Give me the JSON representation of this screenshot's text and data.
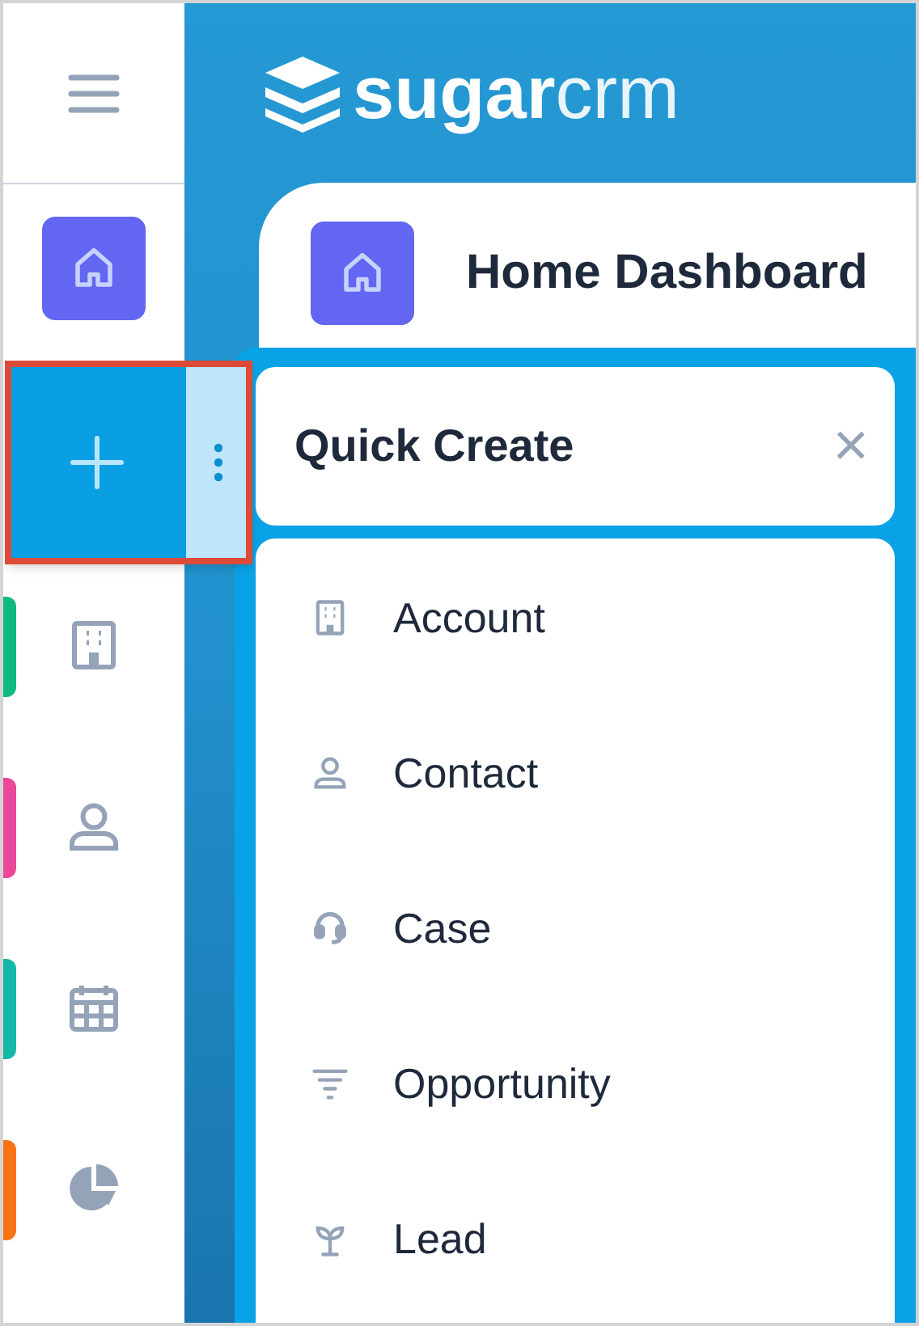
{
  "logo": {
    "bold": "sugar",
    "light": "crm"
  },
  "sidebar": {
    "items": [
      {
        "color": "#10b981"
      },
      {
        "color": "#ec4899"
      },
      {
        "color": "#14b8a6"
      },
      {
        "color": "#f97316"
      }
    ]
  },
  "dashboard": {
    "title": "Home Dashboard"
  },
  "quick_create": {
    "title": "Quick Create",
    "close": "×",
    "items": [
      {
        "label": "Account"
      },
      {
        "label": "Contact"
      },
      {
        "label": "Case"
      },
      {
        "label": "Opportunity"
      },
      {
        "label": "Lead"
      }
    ]
  }
}
